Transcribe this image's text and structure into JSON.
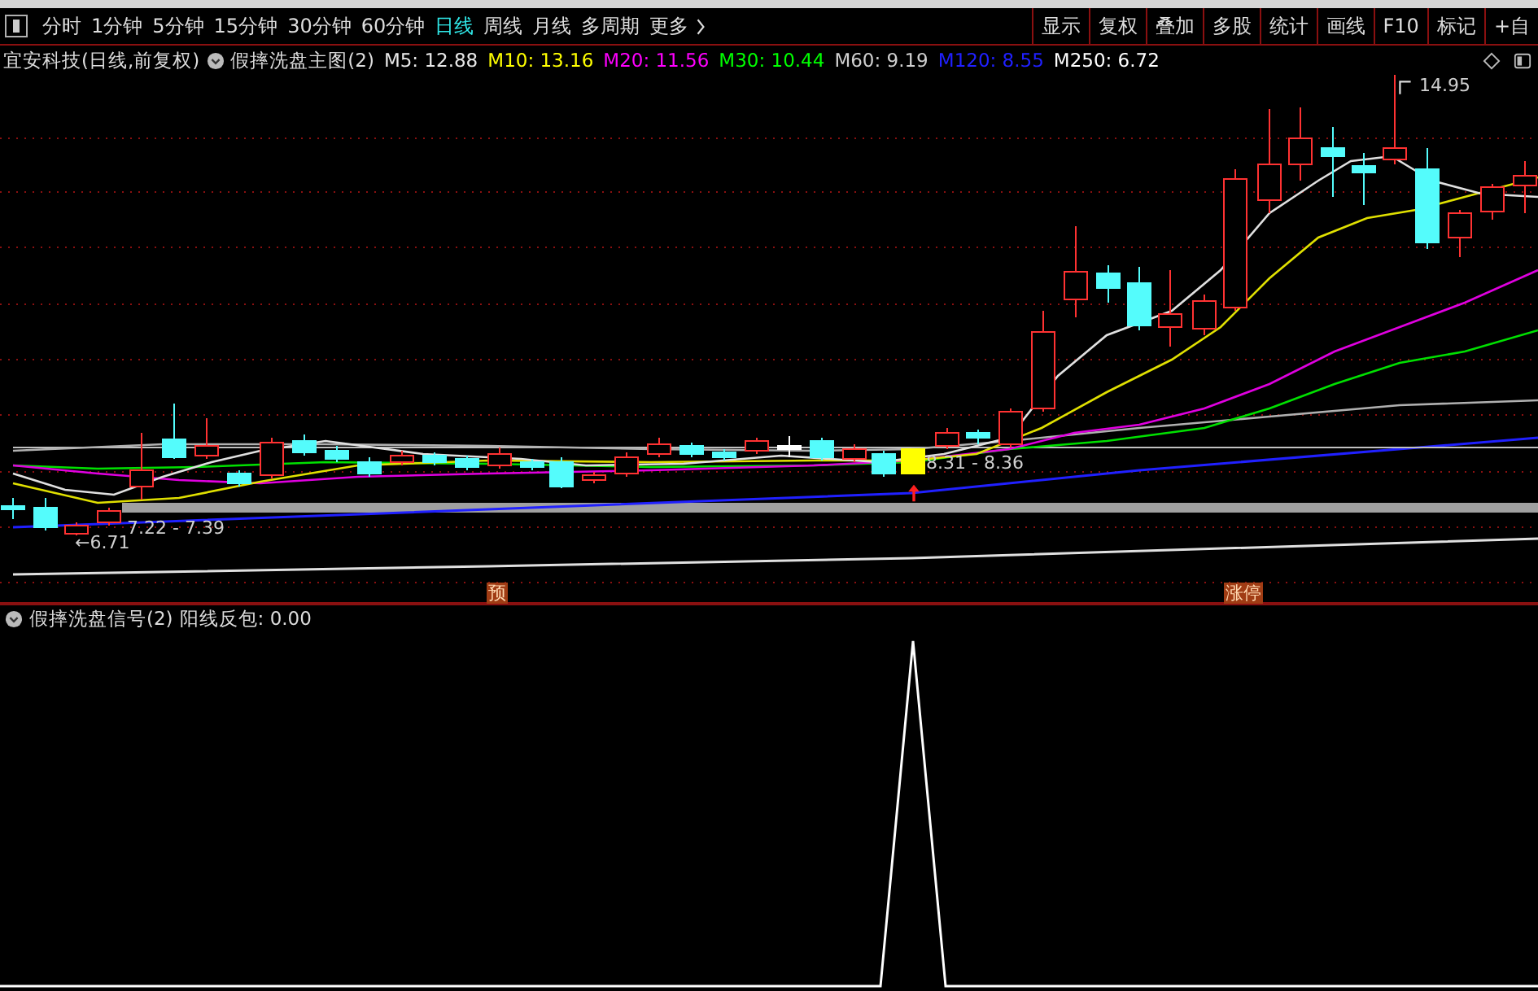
{
  "toolbar": {
    "periods": [
      {
        "label": "分时",
        "selected": false
      },
      {
        "label": "1分钟",
        "selected": false
      },
      {
        "label": "5分钟",
        "selected": false
      },
      {
        "label": "15分钟",
        "selected": false
      },
      {
        "label": "30分钟",
        "selected": false
      },
      {
        "label": "60分钟",
        "selected": false
      },
      {
        "label": "日线",
        "selected": true
      },
      {
        "label": "周线",
        "selected": false
      },
      {
        "label": "月线",
        "selected": false
      },
      {
        "label": "多周期",
        "selected": false
      },
      {
        "label": "更多",
        "selected": false
      }
    ],
    "actions": [
      "显示",
      "复权",
      "叠加",
      "多股",
      "统计",
      "画线",
      "F10",
      "标记",
      "+自"
    ]
  },
  "main_chart": {
    "stock": "宜安科技(日线,前复权)",
    "indicator": "假摔洗盘主图(2)",
    "averages": [
      {
        "label": "M5: 12.88",
        "color": "#e8e8e8"
      },
      {
        "label": "M10: 13.16",
        "color": "#ffff00"
      },
      {
        "label": "M20: 11.56",
        "color": "#ff00ff"
      },
      {
        "label": "M30: 10.44",
        "color": "#00ff00"
      },
      {
        "label": "M60: 9.19",
        "color": "#d0d0d0"
      },
      {
        "label": "M120: 8.55",
        "color": "#2020ff"
      },
      {
        "label": "M250: 6.72",
        "color": "#ffffff"
      }
    ],
    "labels": [
      "14.95",
      "8.31 - 8.36",
      "7.22 - 7.39",
      "←6.71"
    ],
    "markers": [
      "预",
      "涨停"
    ]
  },
  "sub_chart": {
    "indicator": "假摔洗盘信号(2)",
    "reading": "阳线反包: 0.00"
  }
}
